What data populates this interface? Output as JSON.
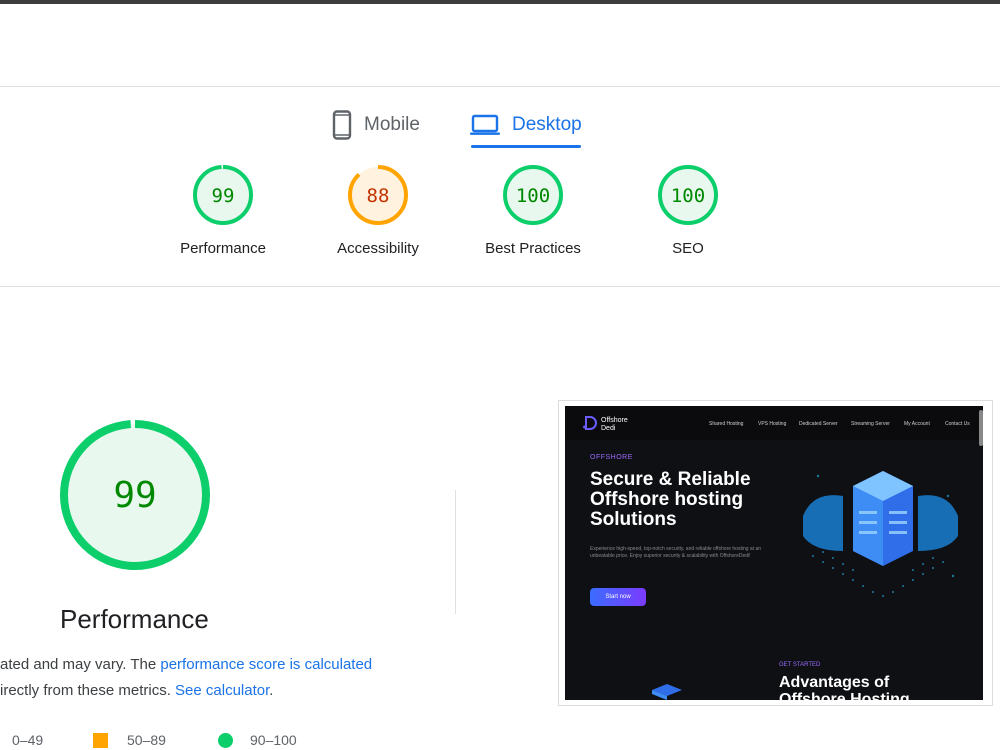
{
  "tabs": {
    "mobile": "Mobile",
    "desktop": "Desktop",
    "active": "desktop"
  },
  "scores": [
    {
      "label": "Performance",
      "value": "99",
      "status": "good"
    },
    {
      "label": "Accessibility",
      "value": "88",
      "status": "average"
    },
    {
      "label": "Best Practices",
      "value": "100",
      "status": "good"
    },
    {
      "label": "SEO",
      "value": "100",
      "status": "good"
    }
  ],
  "colors": {
    "good": "#0cce6b",
    "good_text": "#008800",
    "good_fill": "#e8f8ee",
    "average": "#ffa400",
    "average_text": "#c33300",
    "average_fill": "#fff3e0",
    "accent": "#1a73e8"
  },
  "performance_detail": {
    "score": "99",
    "title": "Performance",
    "desc_part1": "ated and may vary. The ",
    "desc_link1": "performance score is calculated",
    "desc_part2": "irectly from these metrics. ",
    "desc_link2": "See calculator",
    "desc_end": "."
  },
  "legend": [
    {
      "range": "0–49",
      "icon": "triangle-fail-icon"
    },
    {
      "range": "50–89",
      "icon": "square-average-icon"
    },
    {
      "range": "90–100",
      "icon": "circle-pass-icon"
    }
  ],
  "screenshot": {
    "logo_line1": "Offshore",
    "logo_line2": "Dedi",
    "nav": [
      "Shared Hosting",
      "VPS Hosting",
      "Dedicated Server",
      "Streaming Server",
      "My Account",
      "Contact Us"
    ],
    "eyebrow": "OFFSHORE",
    "hero_line1": "Secure & Reliable",
    "hero_line2": "Offshore hosting",
    "hero_line3": "Solutions",
    "hero_desc": "Experience high-speed, top-notch security, and reliable offshore hosting at an unbeatable price. Enjoy superior security & scalability with OffshoreDedi!",
    "cta": "Start now",
    "get_started": "GET STARTED",
    "adv_title_line1": "Advantages of",
    "adv_title_line2": "Offshore Hosting"
  }
}
